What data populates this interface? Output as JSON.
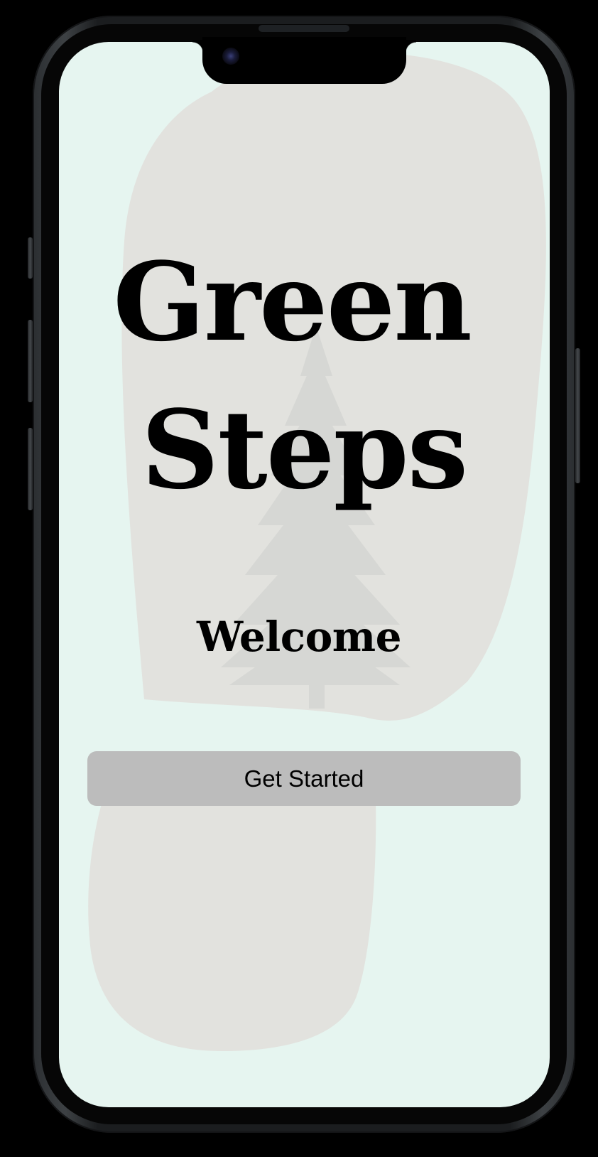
{
  "app": {
    "title_line_1": "Green",
    "title_line_2": "Steps",
    "subtitle": "Welcome"
  },
  "actions": {
    "get_started_label": "Get Started"
  },
  "icons": {
    "background_art": "footprint-with-pine-tree-icon",
    "camera": "front-camera-icon"
  },
  "colors": {
    "screen_background": "#e6f5f0",
    "footprint": "#e2e2de",
    "tree": "#d6d7d4",
    "button_background": "#bcbcbc",
    "text": "#000000"
  }
}
